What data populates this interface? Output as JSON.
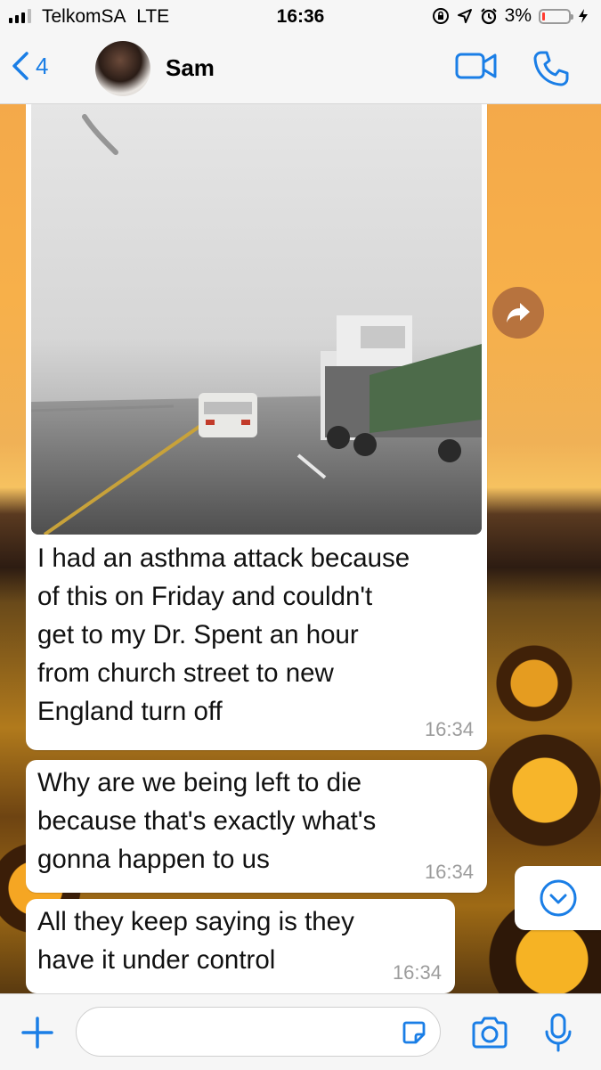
{
  "status_bar": {
    "carrier": "TelkomSA",
    "network": "LTE",
    "time": "16:36",
    "battery": "3%"
  },
  "header": {
    "back_count": "4",
    "contact_name": "Sam"
  },
  "messages": [
    {
      "type": "image",
      "text": [
        "I had an asthma attack because",
        "of this on Friday and couldn't",
        "get to my Dr. Spent an hour",
        "from church street to new",
        "England turn off"
      ],
      "time": "16:34"
    },
    {
      "type": "text",
      "text": [
        "Why are we being left to die",
        "because that's exactly what's",
        "gonna happen to us"
      ],
      "time": "16:34"
    },
    {
      "type": "text",
      "text": [
        "All they keep saying is they",
        "have it under control"
      ],
      "time": "16:34"
    }
  ],
  "input": {
    "placeholder": ""
  },
  "colors": {
    "accent": "#1a7ee6",
    "bubble": "#ffffff",
    "time_text": "#9c9c9c"
  }
}
